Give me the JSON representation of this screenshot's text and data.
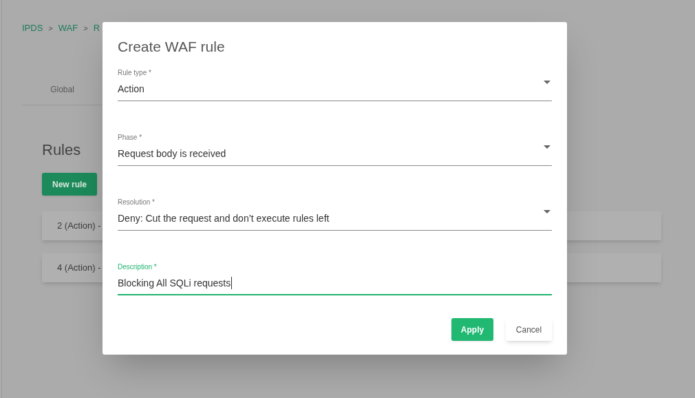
{
  "page": {
    "breadcrumb": [
      {
        "label": "IPDS",
        "kind": "link"
      },
      {
        "label": ">",
        "kind": "separator"
      },
      {
        "label": "WAF",
        "kind": "link"
      },
      {
        "label": ">",
        "kind": "separator"
      },
      {
        "label": "R",
        "kind": "link"
      }
    ],
    "tabs": [
      {
        "label": "Global",
        "selected": false
      }
    ],
    "heading": "Rules",
    "new_rule_button": "New rule",
    "rules": [
      "2 (Action) -",
      "4 (Action) -"
    ]
  },
  "dialog": {
    "title": "Create WAF rule",
    "fields": [
      {
        "kind": "select",
        "label": "Rule type *",
        "value": "Action",
        "focused": false
      },
      {
        "kind": "select",
        "label": "Phase *",
        "value": "Request body is received",
        "focused": false
      },
      {
        "kind": "select",
        "label": "Resolution *",
        "value": "Deny: Cut the request and don’t execute rules left",
        "focused": false
      },
      {
        "kind": "text",
        "label": "Description *",
        "value": "Blocking All SQLi requests",
        "focused": true
      }
    ],
    "buttons": [
      {
        "label": "Apply",
        "kind": "primary"
      },
      {
        "label": "Cancel",
        "kind": "secondary"
      }
    ]
  }
}
